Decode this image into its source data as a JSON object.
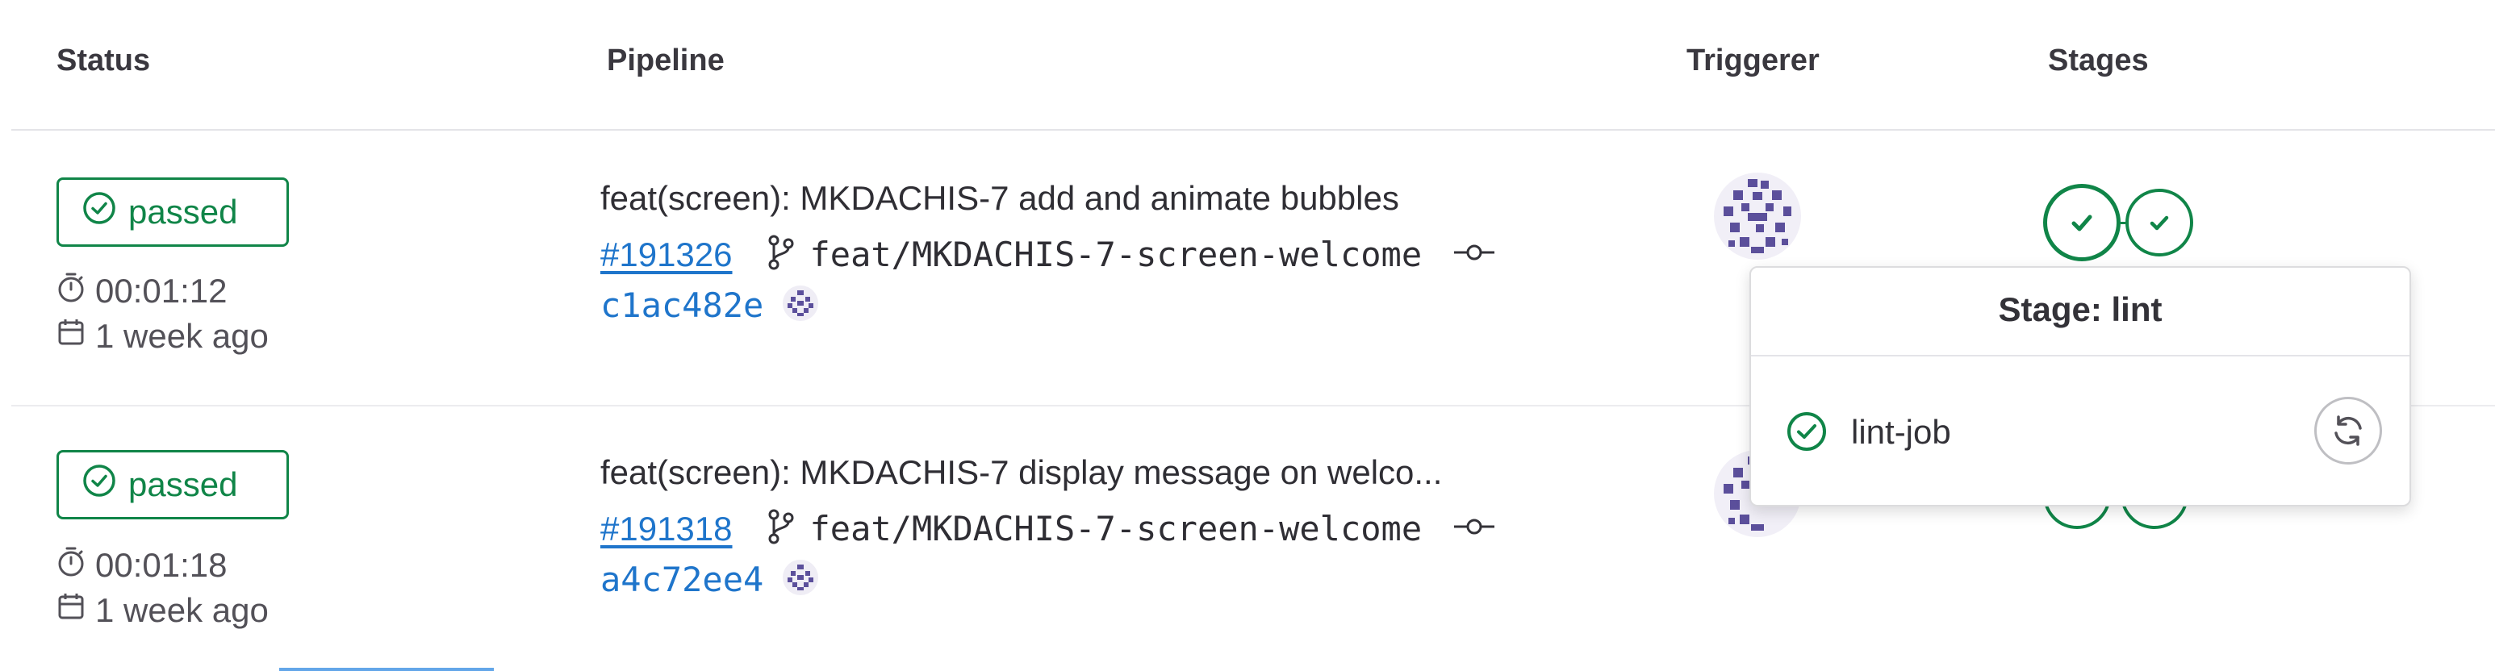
{
  "table": {
    "headers": {
      "status": "Status",
      "pipeline": "Pipeline",
      "triggerer": "Triggerer",
      "stages": "Stages"
    },
    "rows": [
      {
        "status": "passed",
        "duration": "00:01:12",
        "finished": "1 week ago",
        "commit_title": "feat(screen): MKDACHIS-7 add and animate bubbles",
        "pipeline_id": "#191326",
        "branch": "feat/MKDACHIS-7-screen-welcome",
        "sha": "c1ac482e"
      },
      {
        "status": "passed",
        "duration": "00:01:18",
        "finished": "1 week ago",
        "commit_title": "feat(screen): MKDACHIS-7 display message on welco...",
        "pipeline_id": "#191318",
        "branch": "feat/MKDACHIS-7-screen-welcome",
        "sha": "a4c72ee4"
      }
    ]
  },
  "popover": {
    "title": "Stage: lint",
    "job": "lint-job"
  },
  "colors": {
    "success": "#108548",
    "link": "#1f75cb",
    "avatar": "#5b4f9b"
  },
  "icons": [
    "check-circle-icon",
    "timer-icon",
    "calendar-icon",
    "branch-icon",
    "commit-icon",
    "avatar-identicon",
    "retry-icon"
  ]
}
